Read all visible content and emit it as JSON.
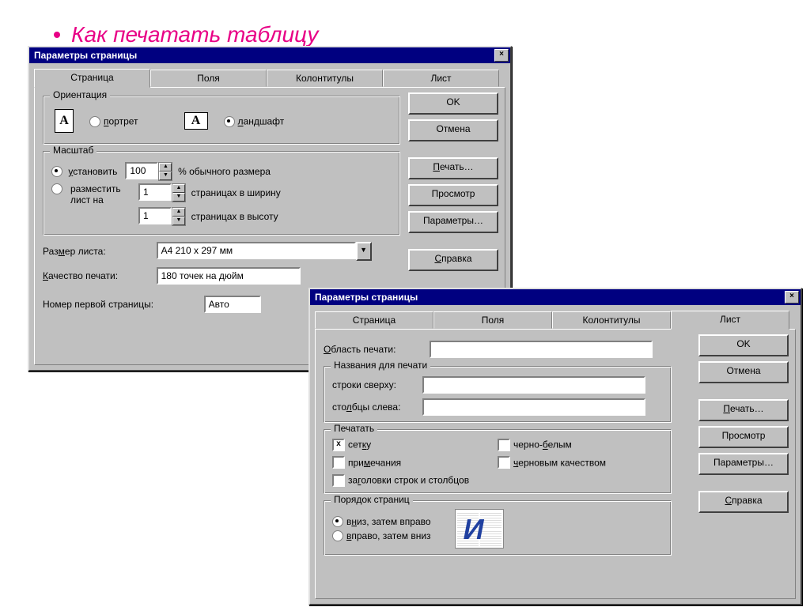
{
  "heading": "Как печатать таблицу",
  "dlg1": {
    "title": "Параметры страницы",
    "tabs": [
      "Страница",
      "Поля",
      "Колонтитулы",
      "Лист"
    ],
    "active_tab": 0,
    "orientation": {
      "legend": "Ориентация",
      "portrait_label": "портрет",
      "landscape_label": "ландшафт",
      "selected": "landscape"
    },
    "scale": {
      "legend": "Масштаб",
      "set_label": "установить",
      "set_value": "100",
      "set_suffix": "% обычного размера",
      "fit_label": "разместить лист на",
      "fit_wide_value": "1",
      "fit_wide_suffix": "страницах в ширину",
      "fit_tall_value": "1",
      "fit_tall_suffix": "страницах в высоту",
      "selected": "set"
    },
    "paper_size_label": "Размер листа:",
    "paper_size_value": "A4 210 x 297 мм",
    "print_quality_label": "Качество печати:",
    "print_quality_value": "180 точек на дюйм",
    "first_page_label": "Номер первой страницы:",
    "first_page_value": "Авто",
    "buttons": {
      "ok": "OK",
      "cancel": "Отмена",
      "print": "Печать…",
      "preview": "Просмотр",
      "options": "Параметры…",
      "help": "Справка"
    }
  },
  "dlg2": {
    "title": "Параметры страницы",
    "tabs": [
      "Страница",
      "Поля",
      "Колонтитулы",
      "Лист"
    ],
    "active_tab": 3,
    "print_area_label": "Область печати:",
    "print_area_value": "",
    "titles": {
      "legend": "Названия для печати",
      "rows_label": "строки сверху:",
      "rows_value": "",
      "cols_label": "столбцы слева:",
      "cols_value": ""
    },
    "print_group": {
      "legend": "Печатать",
      "grid": "сетку",
      "bw": "черно-белым",
      "notes": "примечания",
      "draft": "черновым качеством",
      "headings": "заголовки строк и столбцов",
      "grid_checked": true,
      "bw_checked": false,
      "notes_checked": false,
      "draft_checked": false,
      "headings_checked": false
    },
    "order": {
      "legend": "Порядок страниц",
      "down_label": "вниз, затем вправо",
      "over_label": "вправо, затем вниз",
      "selected": "down"
    },
    "buttons": {
      "ok": "OK",
      "cancel": "Отмена",
      "print": "Печать…",
      "preview": "Просмотр",
      "options": "Параметры…",
      "help": "Справка"
    }
  }
}
